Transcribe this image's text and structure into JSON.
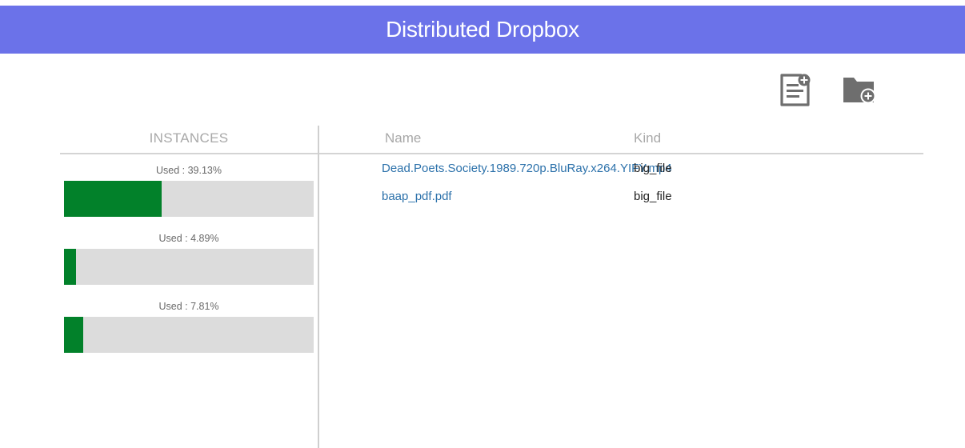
{
  "header": {
    "title": "Distributed Dropbox"
  },
  "toolbar": {
    "new_file_icon": "new-file-icon",
    "new_folder_icon": "new-folder-icon"
  },
  "instances": {
    "title": "INSTANCES",
    "items": [
      {
        "label": "Used : 39.13%",
        "used_fraction": 0.3913
      },
      {
        "label": "Used : 4.89%",
        "used_fraction": 0.0489
      },
      {
        "label": "Used : 7.81%",
        "used_fraction": 0.0781
      }
    ]
  },
  "files": {
    "columns": {
      "name": "Name",
      "kind": "Kind"
    },
    "rows": [
      {
        "name": "Dead.Poets.Society.1989.720p.BluRay.x264.YIFY.mp4",
        "kind": "big_file"
      },
      {
        "name": "baap_pdf.pdf",
        "kind": "big_file"
      }
    ]
  },
  "colors": {
    "header_bg": "#6b72e9",
    "bar_fill": "#02812a",
    "bar_track": "#dcdcdc",
    "link": "#2d72ab"
  }
}
